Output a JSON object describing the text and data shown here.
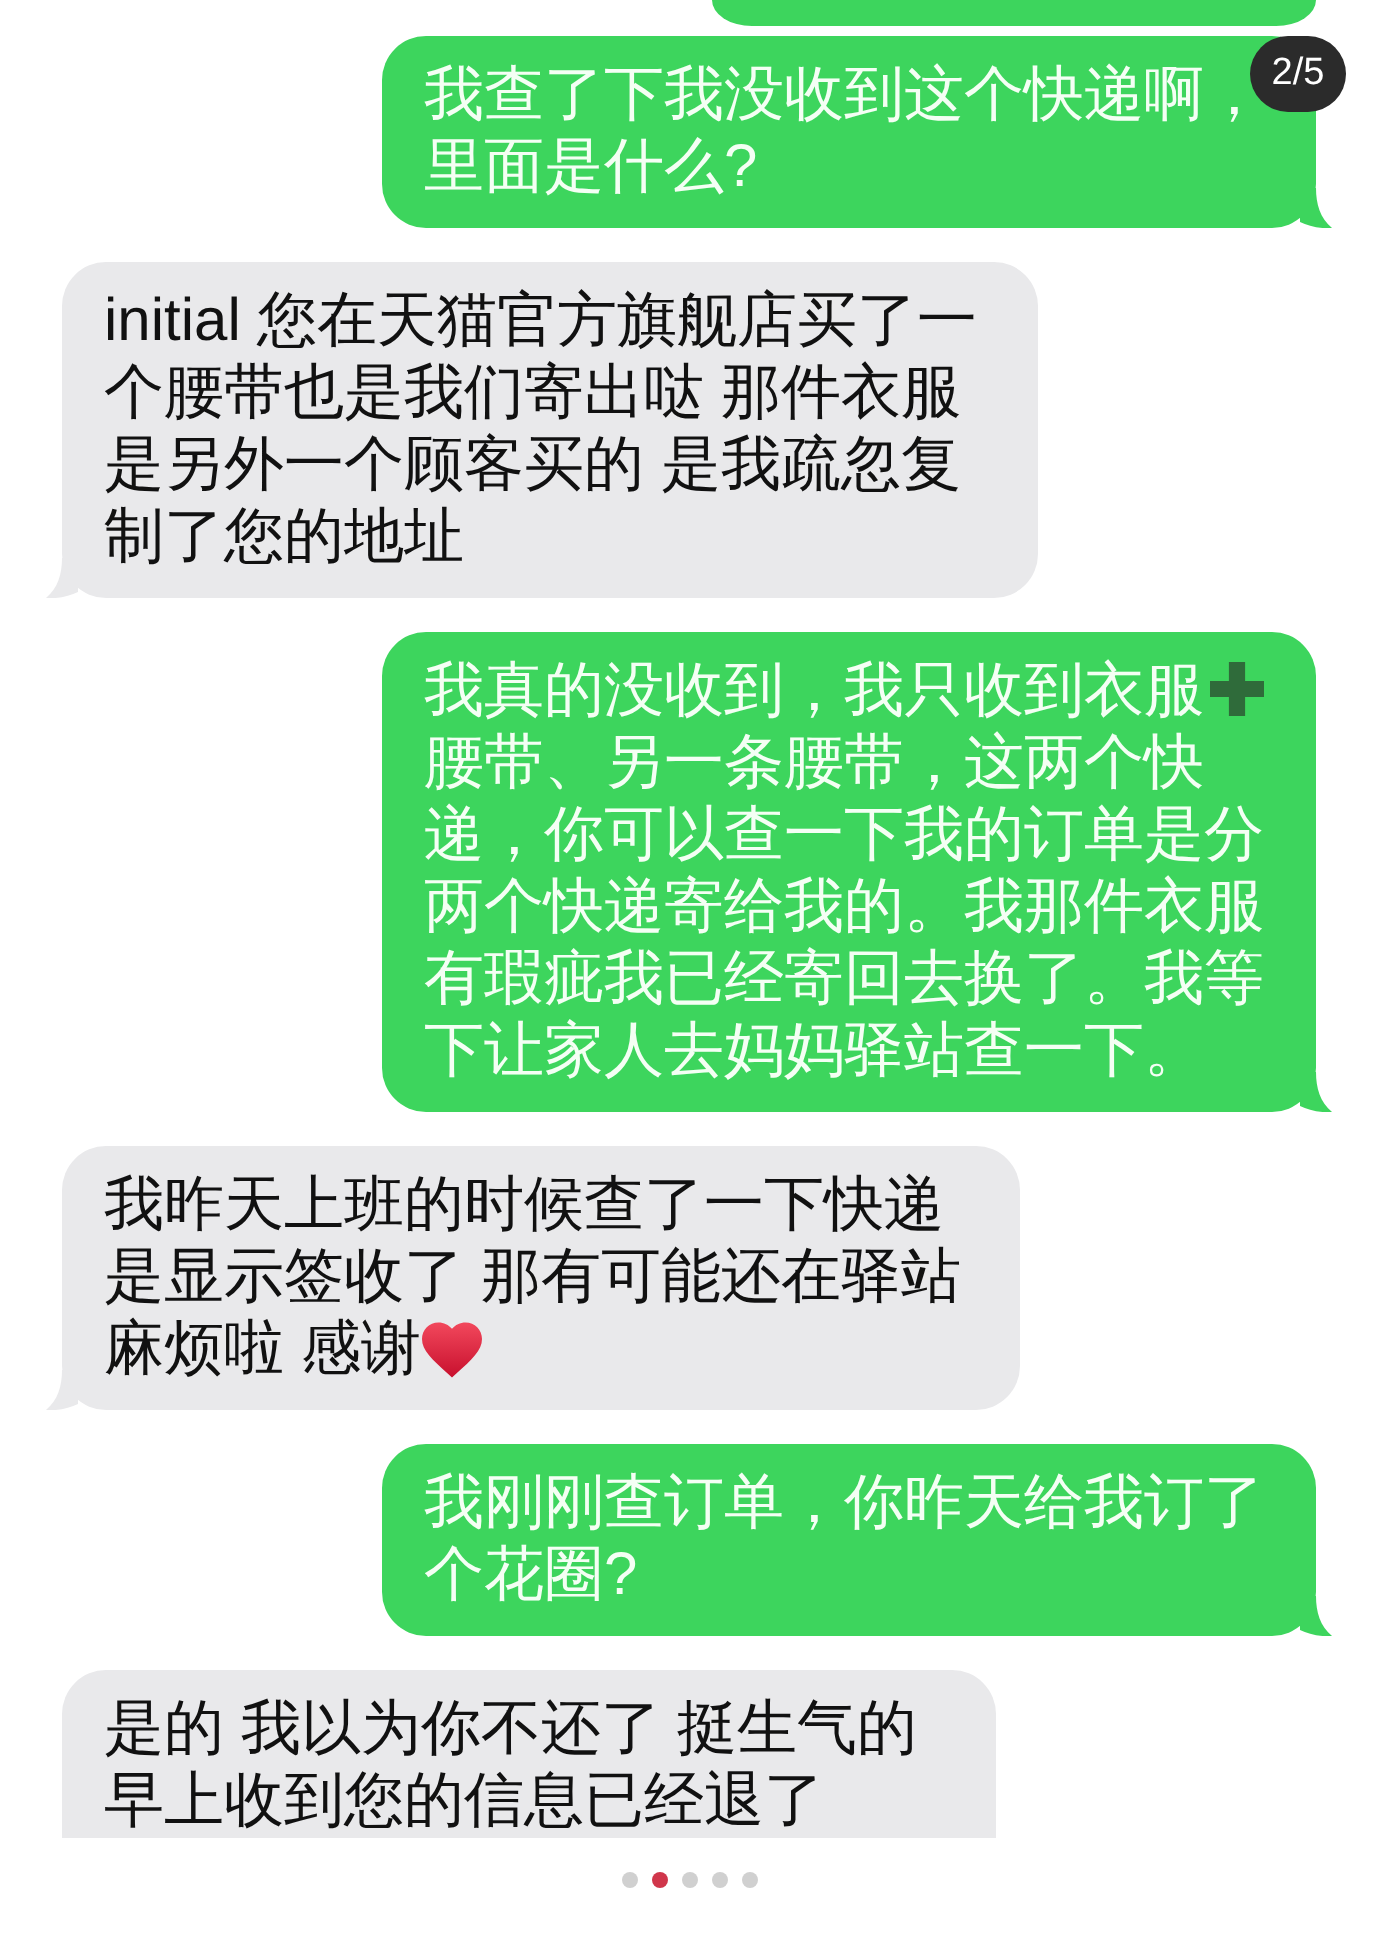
{
  "badge": {
    "text": "2/5"
  },
  "messages": [
    {
      "outgoing": true,
      "cut_top": true
    },
    {
      "outgoing": true,
      "text": "我查了下我没收到这个快递啊，里面是什么?"
    },
    {
      "outgoing": false,
      "text": "initial 您在天猫官方旗舰店买了一个腰带也是我们寄出哒 那件衣服是另外一个顾客买的 是我疏忽复制了您的地址"
    },
    {
      "outgoing": true,
      "parts": [
        {
          "kind": "text",
          "text": "我真的没收到，我只收到衣服"
        },
        {
          "kind": "plus"
        },
        {
          "kind": "text",
          "text": "腰带、另一条腰带，这两个快递，你可以查一下我的订单是分两个快递寄给我的。我那件衣服有瑕疵我已经寄回去换了。我等下让家人去妈妈驿站查一下。"
        }
      ]
    },
    {
      "outgoing": false,
      "parts": [
        {
          "kind": "text",
          "text": "我昨天上班的时候查了一下快递是显示签收了 那有可能还在驿站"
        },
        {
          "kind": "text",
          "text": "麻烦啦 感谢"
        },
        {
          "kind": "heart"
        }
      ]
    },
    {
      "outgoing": true,
      "text": "我刚刚查订单，你昨天给我订了个花圈?"
    },
    {
      "outgoing": false,
      "cut_bottom": true,
      "text": "是的 我以为你不还了 挺生气的早上收到您的信息已经退了"
    }
  ],
  "pager": {
    "dots": [
      {
        "selected": false
      },
      {
        "selected": true
      },
      {
        "selected": false
      },
      {
        "selected": false
      },
      {
        "selected": false
      }
    ]
  }
}
